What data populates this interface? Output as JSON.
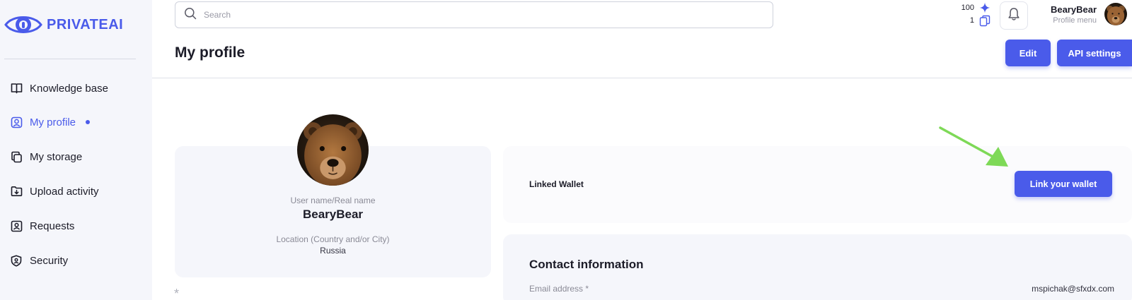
{
  "brand": {
    "name": "PRIVATEAI",
    "color": "#4a5bea"
  },
  "sidebar": {
    "items": [
      {
        "label": "Knowledge base",
        "icon": "book-icon",
        "active": false
      },
      {
        "label": "My profile",
        "icon": "user-icon",
        "active": true
      },
      {
        "label": "My storage",
        "icon": "copy-icon",
        "active": false
      },
      {
        "label": "Upload activity",
        "icon": "folder-upload-icon",
        "active": false
      },
      {
        "label": "Requests",
        "icon": "id-card-icon",
        "active": false
      },
      {
        "label": "Security",
        "icon": "shield-icon",
        "active": false
      }
    ]
  },
  "header": {
    "search": {
      "placeholder": "Search",
      "value": ""
    },
    "counters": {
      "stars": "100",
      "documents": "1"
    },
    "user": {
      "name": "BearyBear",
      "menu_label": "Profile menu"
    }
  },
  "page": {
    "title": "My profile",
    "edit_label": "Edit",
    "api_settings_label": "API settings"
  },
  "profile_card": {
    "name_label": "User name/Real name",
    "name_value": "BearyBear",
    "location_label": "Location (Country and/or City)",
    "location_value": "Russia",
    "asterisk": "*"
  },
  "wallet": {
    "label": "Linked Wallet",
    "button_label": "Link your wallet"
  },
  "contact": {
    "title": "Contact information",
    "email_label": "Email address *",
    "email_value": "mspichak@sfxdx.com"
  },
  "colors": {
    "accent": "#4a5bea",
    "annotation_arrow": "#7ed957",
    "sidebar_bg": "#f5f6fb"
  }
}
